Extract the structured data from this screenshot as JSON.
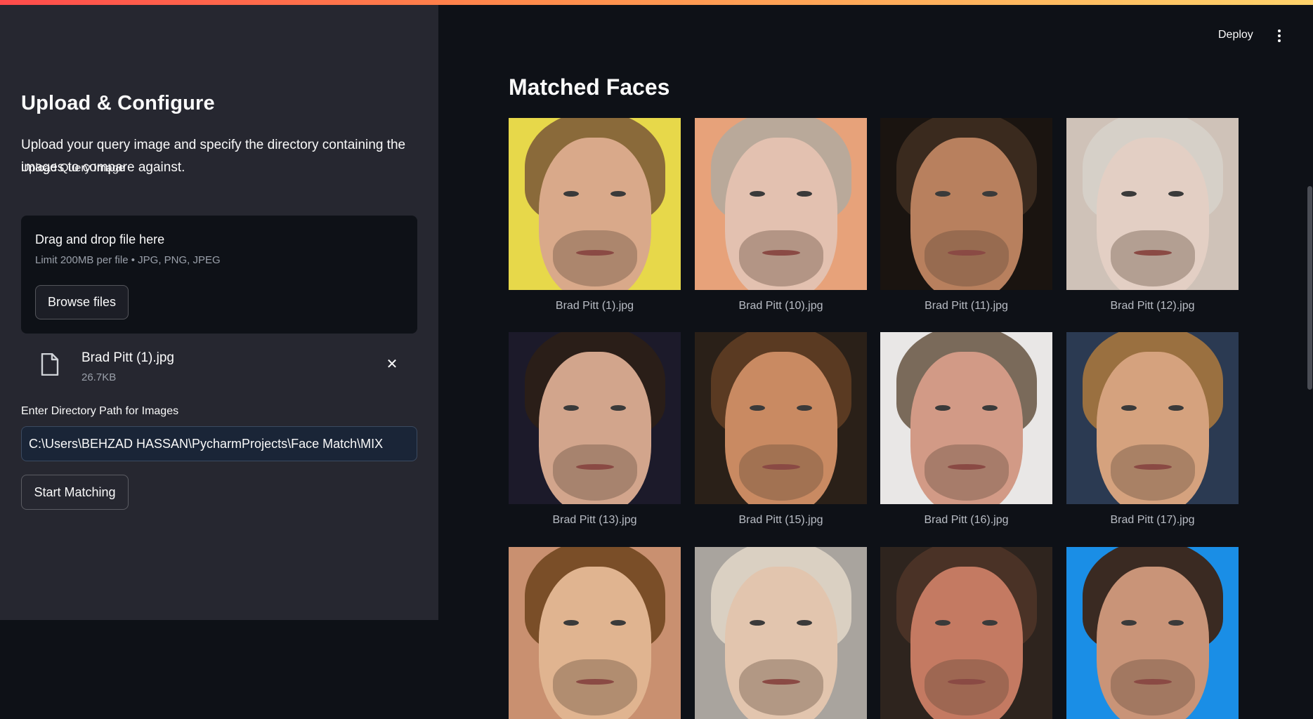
{
  "sidebar": {
    "title": "Upload & Configure",
    "description": "Upload your query image and specify the directory containing the images to compare against.",
    "upload_label": "Upload Query Image",
    "dropzone": {
      "title": "Drag and drop file here",
      "subtitle": "Limit 200MB per file • JPG, PNG, JPEG",
      "browse_label": "Browse files"
    },
    "uploaded_file": {
      "name": "Brad Pitt (1).jpg",
      "size": "26.7KB"
    },
    "directory_label": "Enter Directory Path for Images",
    "directory_value": "C:\\Users\\BEHZAD HASSAN\\PycharmProjects\\Face Match\\MIX",
    "start_label": "Start Matching"
  },
  "header": {
    "deploy_label": "Deploy"
  },
  "main": {
    "title": "Matched Faces",
    "results": [
      {
        "caption": "Brad Pitt (1).jpg",
        "bg": "#e7d84a",
        "skin": "#d9a98a",
        "hair": "#8a6a3a"
      },
      {
        "caption": "Brad Pitt (10).jpg",
        "bg": "#e7a27a",
        "skin": "#e3c1b0",
        "hair": "#b9a99a"
      },
      {
        "caption": "Brad Pitt (11).jpg",
        "bg": "#1a1410",
        "skin": "#b8805e",
        "hair": "#3a2a1e"
      },
      {
        "caption": "Brad Pitt (12).jpg",
        "bg": "#cfc2b8",
        "skin": "#e3cfc4",
        "hair": "#d6d0c8"
      },
      {
        "caption": "Brad Pitt (13).jpg",
        "bg": "#1c1a2a",
        "skin": "#d2a58c",
        "hair": "#2a1e18"
      },
      {
        "caption": "Brad Pitt (15).jpg",
        "bg": "#2a2018",
        "skin": "#c98a62",
        "hair": "#5a3a22"
      },
      {
        "caption": "Brad Pitt (16).jpg",
        "bg": "#e9e7e6",
        "skin": "#d29a86",
        "hair": "#7a6a5a"
      },
      {
        "caption": "Brad Pitt (17).jpg",
        "bg": "#2b3a52",
        "skin": "#d5a27e",
        "hair": "#9a7040"
      },
      {
        "caption": "",
        "bg": "#c99070",
        "skin": "#e0b490",
        "hair": "#7a4e28"
      },
      {
        "caption": "",
        "bg": "#a9a49e",
        "skin": "#e2c5ae",
        "hair": "#dad0c2"
      },
      {
        "caption": "",
        "bg": "#2e241e",
        "skin": "#c47a62",
        "hair": "#4a3226"
      },
      {
        "caption": "",
        "bg": "#1a8ee6",
        "skin": "#c99478",
        "hair": "#3a2a22"
      }
    ]
  },
  "colors": {
    "sidebar_bg": "#262730",
    "main_bg": "#0e1117",
    "accent": "#ff4b4b"
  }
}
